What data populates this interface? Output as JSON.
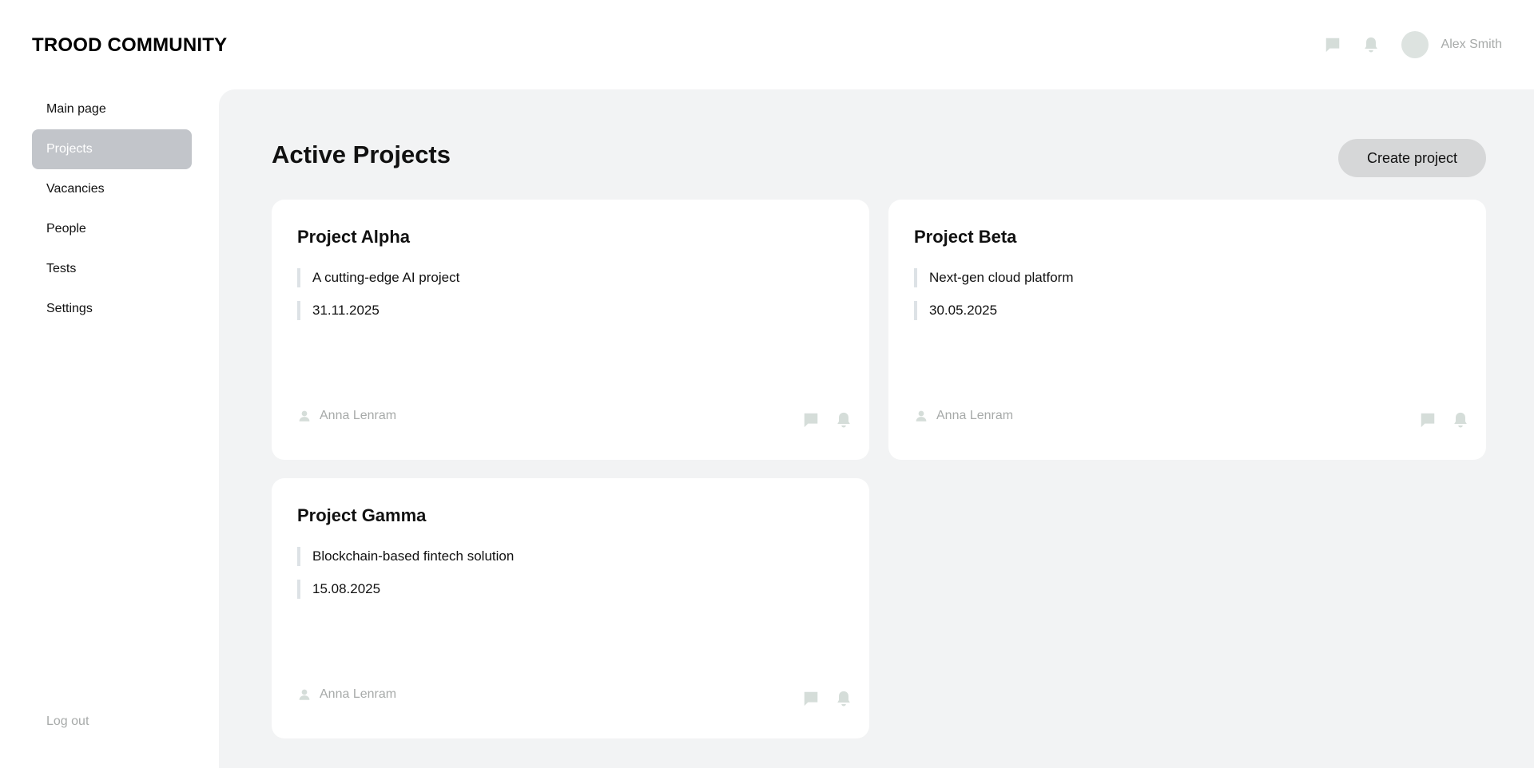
{
  "header": {
    "logo": "TROOD COMMUNITY",
    "icons": [
      "chat-icon",
      "bell-icon"
    ],
    "user_name": "Alex Smith"
  },
  "sidebar": {
    "items": [
      {
        "label": "Main page",
        "active": false
      },
      {
        "label": "Projects",
        "active": true
      },
      {
        "label": "Vacancies",
        "active": false
      },
      {
        "label": "People",
        "active": false
      },
      {
        "label": "Tests",
        "active": false
      },
      {
        "label": "Settings",
        "active": false
      }
    ],
    "logout_label": "Log out"
  },
  "main": {
    "title": "Active Projects",
    "create_label": "Create project",
    "projects": [
      {
        "name": "Project Alpha",
        "description": "A cutting-edge AI project",
        "date": "31.11.2025",
        "owner": "Anna Lenram"
      },
      {
        "name": "Project Beta",
        "description": "Next-gen cloud platform",
        "date": "30.05.2025",
        "owner": "Anna Lenram"
      },
      {
        "name": "Project Gamma",
        "description": "Blockchain-based fintech solution",
        "date": "15.08.2025",
        "owner": "Anna Lenram"
      }
    ]
  },
  "colors": {
    "main_bg": "#f2f3f4",
    "card_bg": "#ffffff",
    "active_nav_bg": "#c2c5ca",
    "button_bg": "#d6d7d8",
    "icon_color": "#d5ddd9",
    "muted_text": "#a7aaa9",
    "accent_bar": "#dde2e6"
  }
}
